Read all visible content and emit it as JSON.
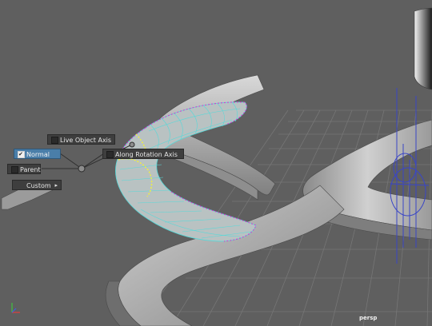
{
  "viewport": {
    "camera_label": "persp"
  },
  "marking_menu": {
    "items": [
      {
        "id": "live",
        "label": "Live Object Axis",
        "checked": false
      },
      {
        "id": "normal",
        "label": "Normal",
        "checked": true
      },
      {
        "id": "rotation",
        "label": "Along Rotation Axis",
        "checked": false
      },
      {
        "id": "parent",
        "label": "Parent",
        "checked": false
      },
      {
        "id": "custom",
        "label": "Custom",
        "submenu_arrow": "▸"
      }
    ]
  },
  "colors": {
    "background": "#5f5f5f",
    "grid": "#747474",
    "mesh_light": "#c9c9c9",
    "mesh_dark": "#7f7f7f",
    "wire_cyan": "#57d9d9",
    "wire_magenta": "#d238d2",
    "wire_yellow": "#f3f23a",
    "wire_blue": "#3a46c6",
    "menu_active": "#4a7ea9"
  },
  "icons": {
    "axis_gizmo": "axis-gizmo-icon"
  }
}
